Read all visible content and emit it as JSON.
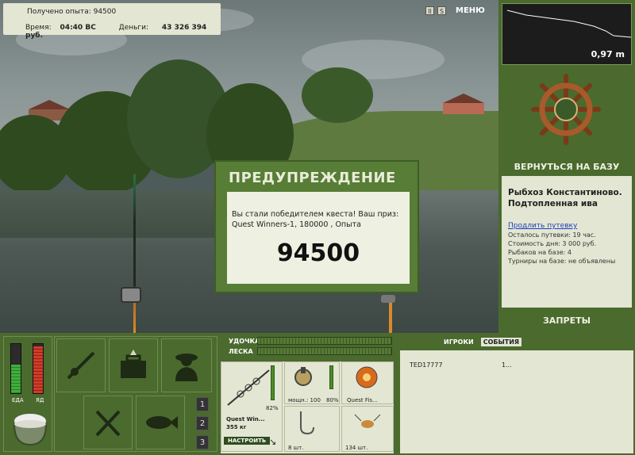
{
  "info": {
    "exp_label": "Получено опыта: 94500",
    "time_label": "Время:",
    "time_value": "04:40 ВС",
    "money_label": "Деньги:",
    "money_value": "43 326 394 руб."
  },
  "scene_buttons": {
    "pause_icon": "II",
    "sound_icon": "S",
    "menu": "МЕНЮ"
  },
  "warning": {
    "title": "ПРЕДУПРЕЖДЕНИЕ",
    "message": "Вы стали победителем квеста! Ваш приз: Quest Winners-1, 180000 , Опыта",
    "value": "94500"
  },
  "depth": {
    "value": "0,97 m"
  },
  "right_panel": {
    "back_to_base": "ВЕРНУТЬСЯ НА БАЗУ",
    "base_name": "Рыбхоз Константиново. Подтопленная ива",
    "extend_trip": "Продлить путевку",
    "stats": [
      "Осталось путевки: 19 час.",
      "Стоимость дня: 3 000 руб.",
      "Рыбаков на базе: 4",
      "Турниры на базе: не объявлены"
    ],
    "bans": "ЗАПРЕТЫ"
  },
  "status_bars": {
    "food_label": "ЕДА",
    "poison_label": "ЯД",
    "food_level": 0.58,
    "poison_level": 0.95
  },
  "tools": {
    "rod_icon": "fishing-rod-icon",
    "box_icon": "tackle-box-icon",
    "fisherman_icon": "fisherman-icon",
    "cutlery_icon": "cutlery-icon",
    "fish_icon": "fish-icon",
    "nums": [
      "1",
      "2",
      "3"
    ]
  },
  "tackle": {
    "rod_label": "УДОЧКА",
    "line_label": "ЛЕСКА",
    "rod_name": "Quest Win...",
    "rod_weight": "355 кг",
    "rod_percent": "82%",
    "setup": "НАСТРОИТЬ",
    "reel_power": "мощн.: 100",
    "reel_percent": "80%",
    "line_name": "Quest Fis...",
    "hook_count": "8 шт.",
    "bait_count": "134 шт."
  },
  "players": {
    "tab_players": "ИГРОКИ",
    "tab_events": "СОБЫТИЯ",
    "rows": [
      {
        "name": "TED17777",
        "value": "1..."
      }
    ]
  },
  "colors": {
    "panel_green": "#4a6a2e",
    "light_box": "#e3e6d2",
    "link_blue": "#1a3fbf"
  }
}
